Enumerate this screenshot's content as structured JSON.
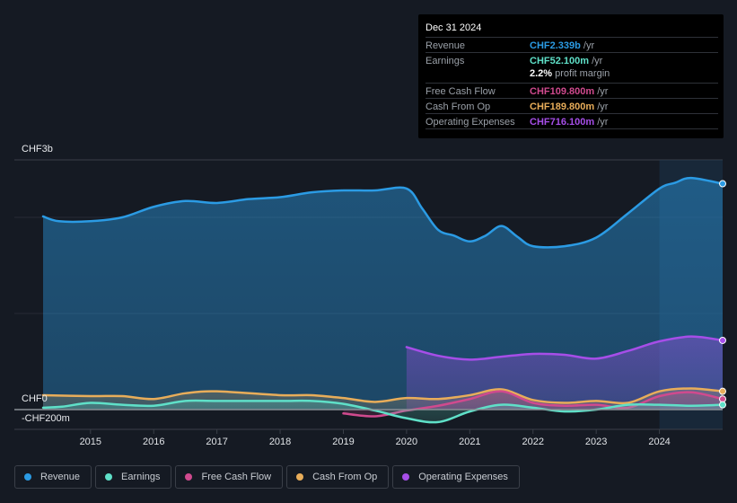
{
  "tooltip": {
    "date": "Dec 31 2024",
    "rows": [
      {
        "label": "Revenue",
        "value": "CHF2.339b",
        "unit": " /yr",
        "color": "#2b9be4"
      },
      {
        "label": "Earnings",
        "value": "CHF52.100m",
        "unit": " /yr",
        "color": "#5fe0c8"
      },
      {
        "label": "Free Cash Flow",
        "value": "CHF109.800m",
        "unit": " /yr",
        "color": "#d04a8e"
      },
      {
        "label": "Cash From Op",
        "value": "CHF189.800m",
        "unit": " /yr",
        "color": "#e8ad5a"
      },
      {
        "label": "Operating Expenses",
        "value": "CHF716.100m",
        "unit": " /yr",
        "color": "#a64ee8"
      }
    ],
    "profit_margin_value": "2.2%",
    "profit_margin_label": " profit margin"
  },
  "chart_data": {
    "type": "area",
    "title": "",
    "xlabel": "",
    "ylabel": "",
    "y_top_label": "CHF3b",
    "y_zero_label": "CHF0",
    "y_neg_label": "-CHF200m",
    "ylim": [
      -0.2,
      2.6
    ],
    "xlim": [
      2014.25,
      2025.0
    ],
    "x_ticks": [
      2015,
      2016,
      2017,
      2018,
      2019,
      2020,
      2021,
      2022,
      2023,
      2024
    ],
    "highlight_range": [
      2024.0,
      2025.0
    ],
    "units": "CHF billions",
    "legend_position": "bottom",
    "series": [
      {
        "name": "Revenue",
        "color": "#2b9be4",
        "fill": true,
        "x": [
          2014.25,
          2014.5,
          2015,
          2015.5,
          2016,
          2016.5,
          2017,
          2017.5,
          2018,
          2018.5,
          2019,
          2019.5,
          2020,
          2020.25,
          2020.5,
          2020.75,
          2021,
          2021.25,
          2021.5,
          2021.75,
          2022,
          2022.5,
          2023,
          2023.5,
          2024,
          2024.25,
          2024.5,
          2025
        ],
        "values": [
          2.01,
          1.96,
          1.96,
          2.0,
          2.11,
          2.17,
          2.15,
          2.19,
          2.21,
          2.26,
          2.28,
          2.28,
          2.3,
          2.09,
          1.87,
          1.81,
          1.75,
          1.81,
          1.91,
          1.8,
          1.7,
          1.7,
          1.79,
          2.04,
          2.3,
          2.36,
          2.41,
          2.35
        ]
      },
      {
        "name": "Operating Expenses",
        "color": "#a64ee8",
        "fill": true,
        "x": [
          2020,
          2020.5,
          2021,
          2021.5,
          2022,
          2022.5,
          2023,
          2023.5,
          2024,
          2024.5,
          2025
        ],
        "values": [
          0.65,
          0.56,
          0.52,
          0.55,
          0.58,
          0.57,
          0.53,
          0.61,
          0.71,
          0.76,
          0.72
        ]
      },
      {
        "name": "Cash From Op",
        "color": "#e8ad5a",
        "fill": true,
        "x": [
          2014.25,
          2015,
          2015.5,
          2016,
          2016.5,
          2017,
          2018,
          2018.5,
          2019,
          2019.5,
          2020,
          2020.5,
          2021,
          2021.5,
          2022,
          2022.5,
          2023,
          2023.5,
          2024,
          2024.5,
          2025
        ],
        "values": [
          0.15,
          0.14,
          0.14,
          0.11,
          0.17,
          0.19,
          0.15,
          0.15,
          0.12,
          0.08,
          0.12,
          0.11,
          0.15,
          0.21,
          0.1,
          0.07,
          0.09,
          0.07,
          0.19,
          0.22,
          0.19
        ]
      },
      {
        "name": "Free Cash Flow",
        "color": "#d04a8e",
        "fill": true,
        "x": [
          2019,
          2019.5,
          2020,
          2020.5,
          2021,
          2021.5,
          2022,
          2022.5,
          2023,
          2023.5,
          2024,
          2024.5,
          2025
        ],
        "values": [
          -0.04,
          -0.07,
          -0.01,
          0.04,
          0.11,
          0.19,
          0.07,
          0.04,
          0.05,
          0.02,
          0.14,
          0.18,
          0.11
        ]
      },
      {
        "name": "Earnings",
        "color": "#5fe0c8",
        "fill": true,
        "x": [
          2014.25,
          2014.55,
          2015,
          2015.5,
          2016,
          2016.5,
          2017,
          2018,
          2018.5,
          2019,
          2019.5,
          2020,
          2020.5,
          2021,
          2021.5,
          2022,
          2022.5,
          2023,
          2023.5,
          2024,
          2024.5,
          2025
        ],
        "values": [
          0.02,
          0.03,
          0.07,
          0.05,
          0.04,
          0.09,
          0.09,
          0.09,
          0.09,
          0.06,
          -0.01,
          -0.09,
          -0.13,
          -0.02,
          0.05,
          0.02,
          -0.02,
          0.0,
          0.05,
          0.05,
          0.04,
          0.05
        ]
      }
    ]
  },
  "legend": [
    {
      "label": "Revenue",
      "color": "#2b9be4"
    },
    {
      "label": "Earnings",
      "color": "#5fe0c8"
    },
    {
      "label": "Free Cash Flow",
      "color": "#d04a8e"
    },
    {
      "label": "Cash From Op",
      "color": "#e8ad5a"
    },
    {
      "label": "Operating Expenses",
      "color": "#a64ee8"
    }
  ]
}
